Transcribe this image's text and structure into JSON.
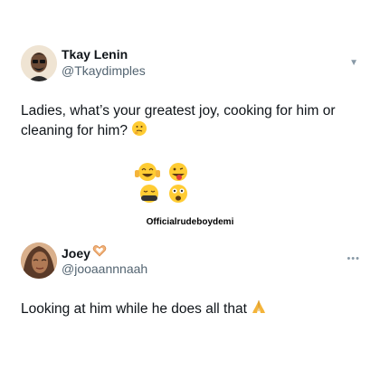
{
  "tweet1": {
    "name": "Tkay Lenin",
    "handle": "@Tkaydimples",
    "text": "Ladies, what’s your greatest joy, cooking for him or cleaning for him?",
    "emoji": "thinking-face",
    "credit": "Officialrudeboydemi",
    "menu_icon": "chevron-down-icon"
  },
  "tweet2": {
    "name": "Joey",
    "name_emoji": "heart-hands",
    "handle": "@jooaannnaah",
    "text": "Looking at him  while he does all that",
    "emoji": "folded-hands",
    "menu_icon": "more-icon"
  }
}
